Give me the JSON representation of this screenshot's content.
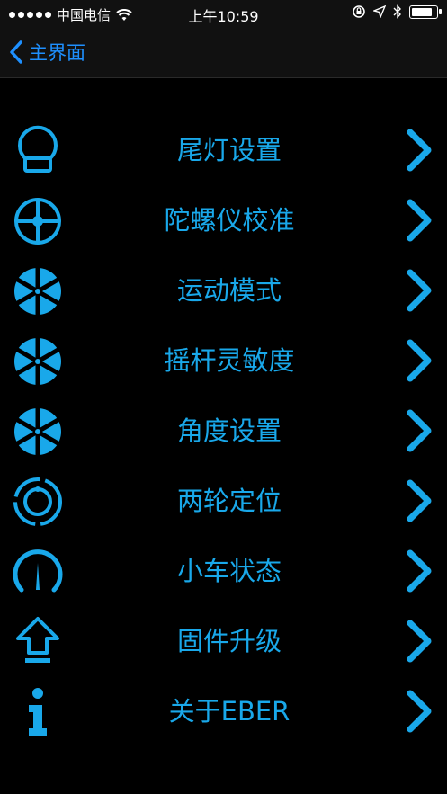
{
  "status_bar": {
    "carrier": "中国电信",
    "time": "上午10:59",
    "battery_level": 0.9
  },
  "nav": {
    "back_label": "主界面"
  },
  "menu": {
    "items": [
      {
        "label": "尾灯设置",
        "icon": "tail-light-icon"
      },
      {
        "label": "陀螺仪校准",
        "icon": "gyroscope-icon"
      },
      {
        "label": "运动模式",
        "icon": "wheel-icon"
      },
      {
        "label": "摇杆灵敏度",
        "icon": "wheel-icon"
      },
      {
        "label": "角度设置",
        "icon": "wheel-icon"
      },
      {
        "label": "两轮定位",
        "icon": "ring-target-icon"
      },
      {
        "label": "小车状态",
        "icon": "gauge-icon"
      },
      {
        "label": "固件升级",
        "icon": "upload-arrow-icon"
      },
      {
        "label": "关于EBER",
        "icon": "info-icon"
      }
    ]
  },
  "colors": {
    "accent": "#19a8ea",
    "nav_accent": "#1e90ff",
    "background": "#000000"
  }
}
